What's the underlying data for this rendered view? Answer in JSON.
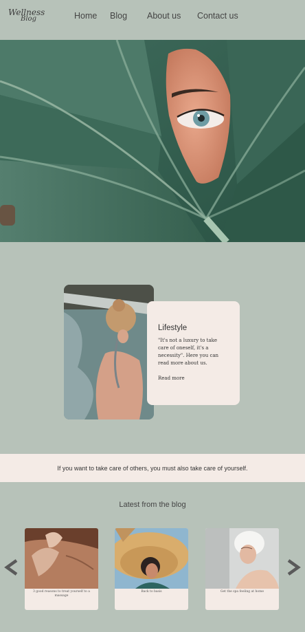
{
  "logo": {
    "line1": "Wellness",
    "line2": "Blog"
  },
  "nav": {
    "home": "Home",
    "blog": "Blog",
    "about": "About us",
    "contact": "Contact us"
  },
  "lifestyle": {
    "title": "Lifestyle",
    "text": "\"It's not a luxury to take care of oneself, it's a necessity\". Here you can read more about us.",
    "read_more": "Read more"
  },
  "quote": "If you want to take care of others, you must also take care of yourself.",
  "blog": {
    "heading": "Latest from the blog",
    "posts": [
      {
        "caption": "3 good reasons to treat yourself to a massage"
      },
      {
        "caption": "Back to basis"
      },
      {
        "caption": "Get the spa feeling at home"
      }
    ]
  },
  "colors": {
    "background": "#b7c2b9",
    "card": "#f4ebe6",
    "text": "#3c3c3c"
  },
  "icons": {
    "prev": "chevron-left-icon",
    "next": "chevron-right-icon"
  }
}
